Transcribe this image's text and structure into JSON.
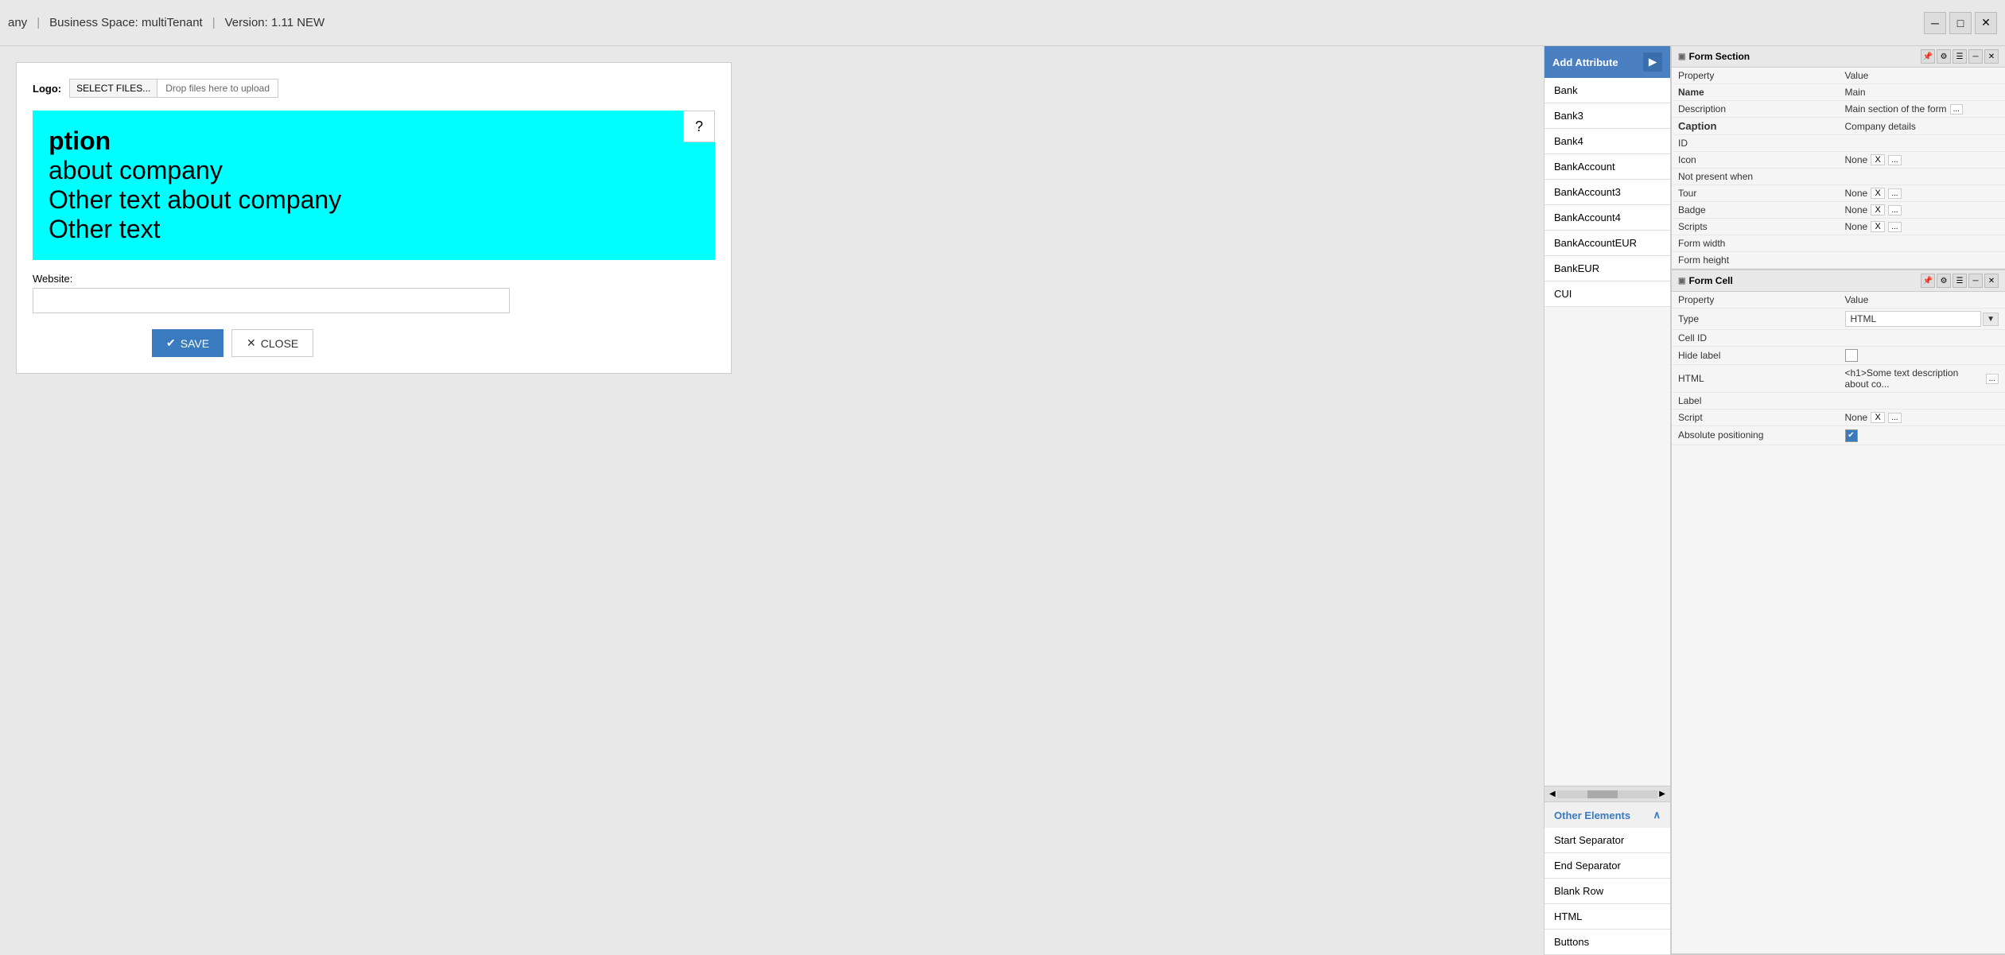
{
  "topbar": {
    "company": "any",
    "separator1": "|",
    "business_space": "Business Space: multiTenant",
    "separator2": "|",
    "version": "Version: 1.11 NEW"
  },
  "form": {
    "logo_label": "Logo:",
    "select_files_btn": "SELECT FILES...",
    "drop_text": "Drop files here to upload",
    "cyan_block": {
      "line1": "ption",
      "line2": "about company",
      "line3": "Other text about company",
      "line4": "Other text"
    },
    "question_mark": "?",
    "website_label": "Website:",
    "save_btn": "SAVE",
    "close_btn": "CLOSE"
  },
  "attr_sidebar": {
    "header_label": "Add Attribute",
    "items": [
      "Bank",
      "Bank3",
      "Bank4",
      "BankAccount",
      "BankAccount3",
      "BankAccount4",
      "BankAccountEUR",
      "BankEUR",
      "CUI"
    ],
    "other_elements_label": "Other Elements",
    "other_elements_items": [
      "Start Separator",
      "End Separator",
      "Blank Row",
      "HTML",
      "Buttons"
    ]
  },
  "form_section_panel": {
    "title": "Form Section",
    "properties": [
      {
        "name": "Property",
        "value": "Value",
        "bold": false
      },
      {
        "name": "Name",
        "value": "Main",
        "bold": true
      },
      {
        "name": "Description",
        "value": "Main section of the form",
        "bold": false,
        "has_dots": true
      },
      {
        "name": "Caption",
        "value": "Company details",
        "bold": true,
        "caption": true
      },
      {
        "name": "ID",
        "value": "",
        "bold": false
      },
      {
        "name": "Icon",
        "value": "None",
        "bold": false,
        "has_x": true,
        "has_dots": true
      },
      {
        "name": "Not present when",
        "value": "",
        "bold": false
      },
      {
        "name": "Tour",
        "value": "None",
        "bold": false,
        "has_x": true,
        "has_dots": true
      },
      {
        "name": "Badge",
        "value": "None",
        "bold": false,
        "has_x": true,
        "has_dots": true
      },
      {
        "name": "Scripts",
        "value": "None",
        "bold": false,
        "has_x": true,
        "has_dots": true
      },
      {
        "name": "Form width",
        "value": "",
        "bold": false
      },
      {
        "name": "Form height",
        "value": "",
        "bold": false
      }
    ]
  },
  "form_cell_panel": {
    "title": "Form Cell",
    "properties": [
      {
        "name": "Property",
        "value": "Value",
        "bold": false
      },
      {
        "name": "Type",
        "value": "HTML",
        "bold": false,
        "is_select": true
      },
      {
        "name": "Cell ID",
        "value": "",
        "bold": false
      },
      {
        "name": "Hide label",
        "value": "",
        "bold": false,
        "is_checkbox": true,
        "checked": false
      },
      {
        "name": "HTML",
        "value": "<h1>Some text description about co...",
        "bold": false,
        "has_dots": true
      },
      {
        "name": "Label",
        "value": "",
        "bold": false
      },
      {
        "name": "Script",
        "value": "None",
        "bold": false,
        "has_x": true,
        "has_dots": true
      },
      {
        "name": "Absolute positioning",
        "value": "",
        "bold": false,
        "is_checkbox": true,
        "checked": true
      }
    ]
  }
}
